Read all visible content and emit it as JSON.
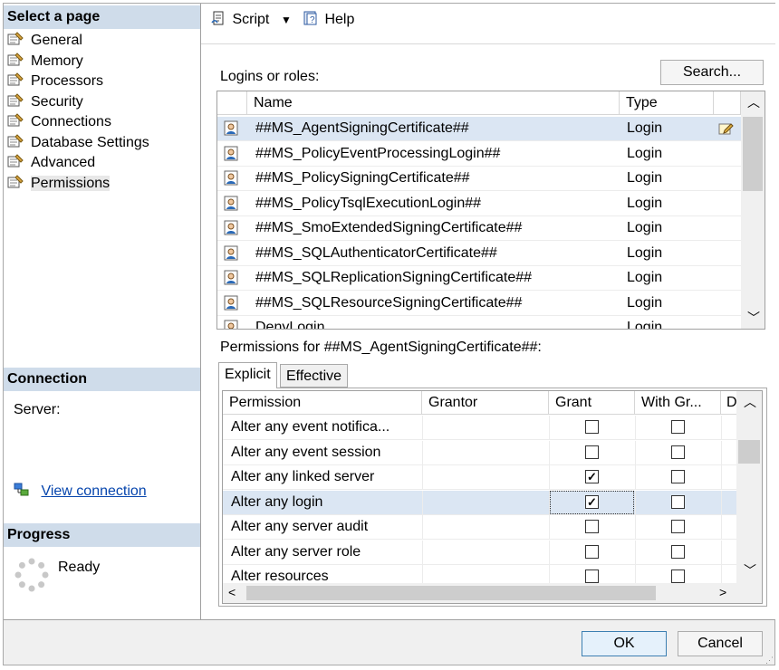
{
  "left_panel": {
    "select_page_header": "Select a page",
    "pages": [
      {
        "label": "General",
        "icon": "wrench-page-icon"
      },
      {
        "label": "Memory",
        "icon": "wrench-page-icon"
      },
      {
        "label": "Processors",
        "icon": "wrench-page-icon"
      },
      {
        "label": "Security",
        "icon": "wrench-page-icon"
      },
      {
        "label": "Connections",
        "icon": "wrench-page-icon"
      },
      {
        "label": "Database Settings",
        "icon": "wrench-page-icon"
      },
      {
        "label": "Advanced",
        "icon": "wrench-page-icon"
      },
      {
        "label": "Permissions",
        "icon": "wrench-page-icon",
        "selected": true
      }
    ],
    "connection_header": "Connection",
    "server_label": "Server:",
    "view_connection_link": "View connection ",
    "progress_header": "Progress",
    "progress_status": "Ready"
  },
  "toolbar": {
    "script_label": "Script",
    "help_label": "Help"
  },
  "logins": {
    "label": "Logins or roles:",
    "search_button": "Search...",
    "columns": [
      "Name",
      "Type"
    ],
    "rows": [
      {
        "name": "##MS_AgentSigningCertificate##",
        "type": "Login"
      },
      {
        "name": "##MS_PolicyEventProcessingLogin##",
        "type": "Login"
      },
      {
        "name": "##MS_PolicySigningCertificate##",
        "type": "Login"
      },
      {
        "name": "##MS_PolicyTsqlExecutionLogin##",
        "type": "Login"
      },
      {
        "name": "##MS_SmoExtendedSigningCertificate##",
        "type": "Login"
      },
      {
        "name": "##MS_SQLAuthenticatorCertificate##",
        "type": "Login"
      },
      {
        "name": "##MS_SQLReplicationSigningCertificate##",
        "type": "Login"
      },
      {
        "name": "##MS_SQLResourceSigningCertificate##",
        "type": "Login"
      },
      {
        "name": "DenyLogin",
        "type": "Login"
      }
    ]
  },
  "permissions": {
    "label": "Permissions for ##MS_AgentSigningCertificate##:",
    "tabs": [
      "Explicit",
      "Effective"
    ],
    "columns": [
      "Permission",
      "Grantor",
      "Grant",
      "With Gr...",
      "D"
    ],
    "rows": [
      {
        "permission": "Alter any event notifica...",
        "grant": false,
        "with_grant": false
      },
      {
        "permission": "Alter any event session",
        "grant": false,
        "with_grant": false
      },
      {
        "permission": "Alter any linked server",
        "grant": true,
        "with_grant": false
      },
      {
        "permission": "Alter any login",
        "grant": true,
        "with_grant": false,
        "selected": true
      },
      {
        "permission": "Alter any server audit",
        "grant": false,
        "with_grant": false
      },
      {
        "permission": "Alter any server role",
        "grant": false,
        "with_grant": false
      },
      {
        "permission": "Alter resources",
        "grant": false,
        "with_grant": false
      }
    ]
  },
  "footer": {
    "ok_button": "OK",
    "cancel_button": "Cancel"
  }
}
